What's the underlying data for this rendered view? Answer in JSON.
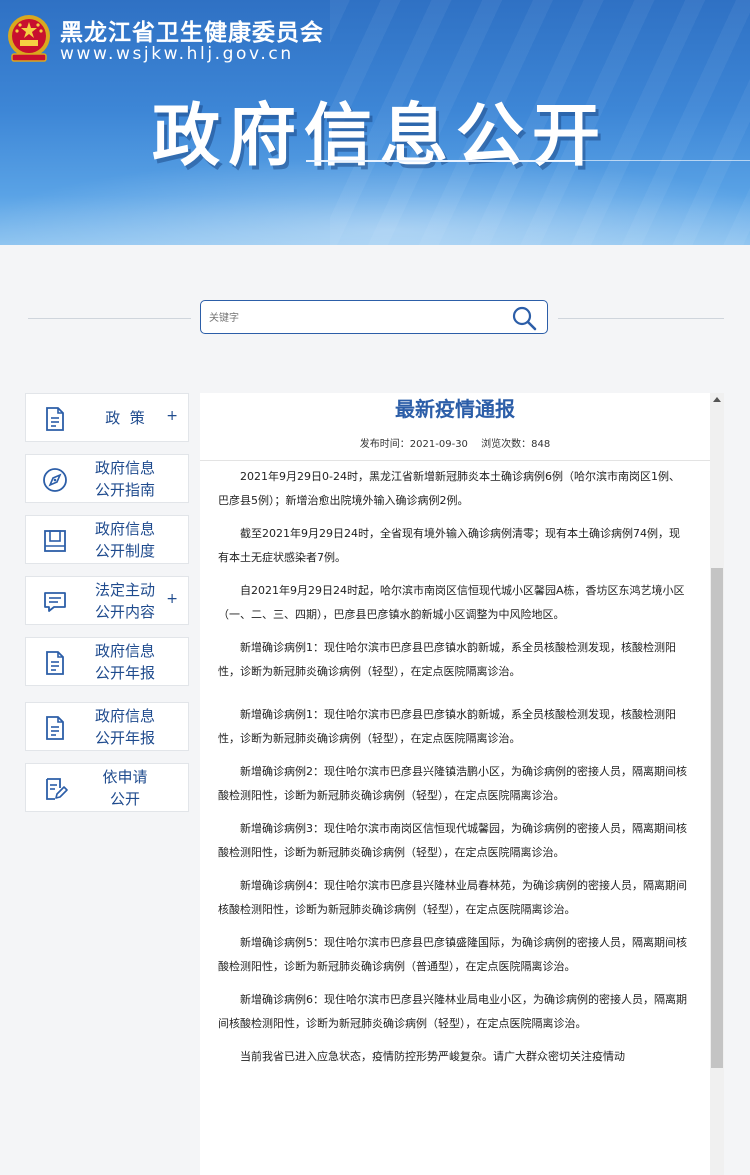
{
  "header": {
    "org_name": "黑龙江省卫生健康委员会",
    "org_url": "www.wsjkw.hlj.gov.cn",
    "banner_title": "政府信息公开"
  },
  "search": {
    "placeholder": "关键字",
    "value": ""
  },
  "sidebar": {
    "items": [
      {
        "label": "政  策",
        "icon": "document-icon",
        "has_expand": true
      },
      {
        "label": "政府信息\n公开指南",
        "icon": "compass-icon",
        "has_expand": false
      },
      {
        "label": "政府信息\n公开制度",
        "icon": "book-icon",
        "has_expand": false
      },
      {
        "label": "法定主动\n公开内容",
        "icon": "chat-icon",
        "has_expand": true
      },
      {
        "label": "政府信息\n公开年报",
        "icon": "document-icon",
        "has_expand": false
      },
      {
        "label": "政府信息\n公开年报",
        "icon": "document-icon",
        "has_expand": false
      },
      {
        "label": "依申请\n公开",
        "icon": "edit-document-icon",
        "has_expand": false
      }
    ],
    "expand_symbol": "+"
  },
  "article": {
    "title": "最新疫情通报",
    "publish_label": "发布时间：",
    "publish_date": "2021-09-30",
    "views_label": "浏览次数：",
    "views": "848",
    "paragraphs": [
      "2021年9月29日0-24时，黑龙江省新增新冠肺炎本土确诊病例6例（哈尔滨市南岗区1例、巴彦县5例）；新增治愈出院境外输入确诊病例2例。",
      "截至2021年9月29日24时，全省现有境外输入确诊病例清零；现有本土确诊病例74例，现有本土无症状感染者7例。",
      "自2021年9月29日24时起，哈尔滨市南岗区信恒现代城小区馨园A栋，香坊区东鸿艺境小区（一、二、三、四期），巴彦县巴彦镇水韵新城小区调整为中风险地区。",
      "新增确诊病例1：现住哈尔滨市巴彦县巴彦镇水韵新城，系全员核酸检测发现，核酸检测阳性，诊断为新冠肺炎确诊病例（轻型），在定点医院隔离诊治。",
      "新增确诊病例1：现住哈尔滨市巴彦县巴彦镇水韵新城，系全员核酸检测发现，核酸检测阳性，诊断为新冠肺炎确诊病例（轻型），在定点医院隔离诊治。",
      "新增确诊病例2：现住哈尔滨市巴彦县兴隆镇浩鹏小区，为确诊病例的密接人员，隔离期间核酸检测阳性，诊断为新冠肺炎确诊病例（轻型），在定点医院隔离诊治。",
      "新增确诊病例3：现住哈尔滨市南岗区信恒现代城馨园，为确诊病例的密接人员，隔离期间核酸检测阳性，诊断为新冠肺炎确诊病例（轻型），在定点医院隔离诊治。",
      "新增确诊病例4：现住哈尔滨市巴彦县兴隆林业局春林苑，为确诊病例的密接人员，隔离期间核酸检测阳性，诊断为新冠肺炎确诊病例（轻型），在定点医院隔离诊治。",
      "新增确诊病例5：现住哈尔滨市巴彦县巴彦镇盛隆国际，为确诊病例的密接人员，隔离期间核酸检测阳性，诊断为新冠肺炎确诊病例（普通型），在定点医院隔离诊治。",
      "新增确诊病例6：现住哈尔滨市巴彦县兴隆林业局电业小区，为确诊病例的密接人员，隔离期间核酸检测阳性，诊断为新冠肺炎确诊病例（轻型），在定点医院隔离诊治。",
      "当前我省已进入应急状态，疫情防控形势严峻复杂。请广大群众密切关注疫情动"
    ]
  },
  "colors": {
    "brand_blue": "#2c5ea8",
    "nav_text": "#1f4b8e",
    "header_blue": "#3d86d6"
  }
}
